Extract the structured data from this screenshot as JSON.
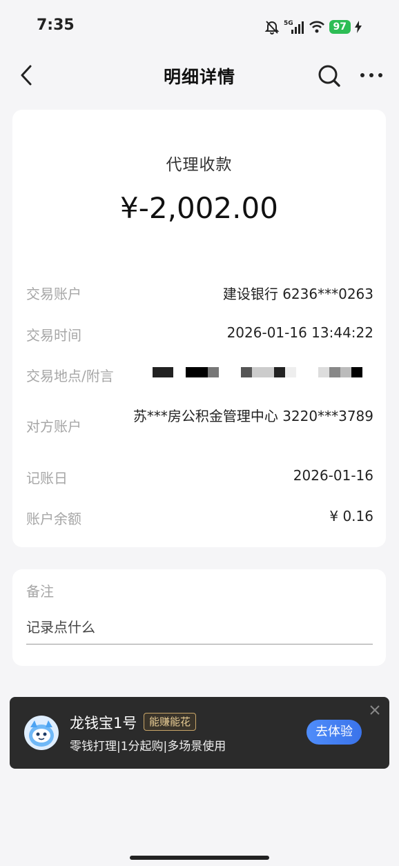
{
  "status_bar": {
    "time": "7:35",
    "network": "5G",
    "battery": "97",
    "icons": [
      "bell-muted-icon",
      "signal-icon",
      "wifi-icon",
      "battery-icon",
      "charging-icon"
    ]
  },
  "nav": {
    "title": "明细详情",
    "icons": [
      "back-icon",
      "search-icon",
      "more-icon"
    ]
  },
  "transaction": {
    "type": "代理收款",
    "amount": "¥-2,002.00",
    "rows": [
      {
        "label": "交易账户",
        "value": "建设银行 6236***0263"
      },
      {
        "label": "交易时间",
        "value": "2026-01-16 13:44:22"
      },
      {
        "label": "交易地点/附言",
        "value": ""
      },
      {
        "label": "对方账户",
        "value": "苏***房公积金管理中心 3220***3789"
      },
      {
        "label": "记账日",
        "value": "2026-01-16"
      },
      {
        "label": "账户余额",
        "value": "¥ 0.16"
      }
    ]
  },
  "note": {
    "label": "备注",
    "placeholder": "记录点什么"
  },
  "promo": {
    "title": "龙钱宝1号",
    "badge": "能赚能花",
    "subtitle": "零钱打理|1分起购|多场景使用",
    "button": "去体验",
    "icons": [
      "mascot-avatar-icon",
      "close-icon"
    ]
  },
  "colors": {
    "background": "#f5f5f7",
    "card": "#ffffff",
    "label": "#a6a6a6",
    "promo_bg": "#2b2b2b",
    "promo_button": "#3f7ef2",
    "badge_gold": "#c9a76a",
    "battery_green": "#2dbd55"
  }
}
